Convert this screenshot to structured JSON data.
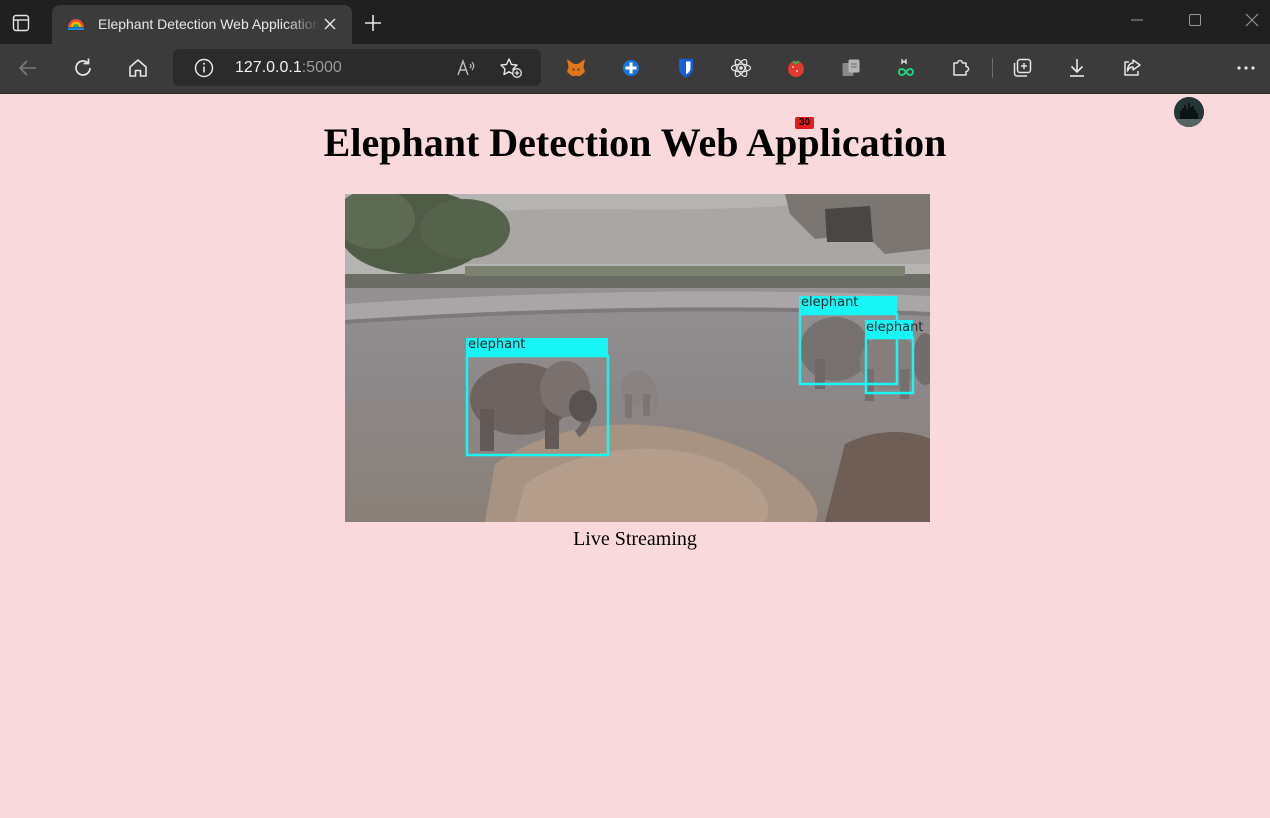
{
  "browser": {
    "tab_title": "Elephant Detection Web Application",
    "address_host": "127.0.0.1",
    "address_port": ":5000",
    "extension_badge": "30",
    "icons": [
      "sidebar-tabs-icon",
      "tab-favicon",
      "close-icon",
      "plus-icon",
      "minimize-icon",
      "maximize-icon",
      "window-close-icon",
      "back-icon",
      "refresh-icon",
      "home-icon",
      "info-icon",
      "read-aloud-icon",
      "add-favorite-icon",
      "metamask-icon",
      "blue-extension-icon",
      "bitwarden-icon",
      "react-devtools-icon",
      "tomato-timer-icon",
      "copy-extension-icon",
      "mapper-extension-icon",
      "extensions-icon",
      "collections-icon",
      "downloads-icon",
      "share-icon",
      "profile-avatar",
      "more-icon"
    ]
  },
  "page": {
    "heading": "Elephant Detection Web Application",
    "stream_caption": "Live Streaming",
    "detections": [
      {
        "label": "elephant"
      },
      {
        "label": "elephant"
      },
      {
        "label": "elephant"
      }
    ],
    "detection_color": "#18f5f5",
    "background_color": "#f9d9dc"
  }
}
